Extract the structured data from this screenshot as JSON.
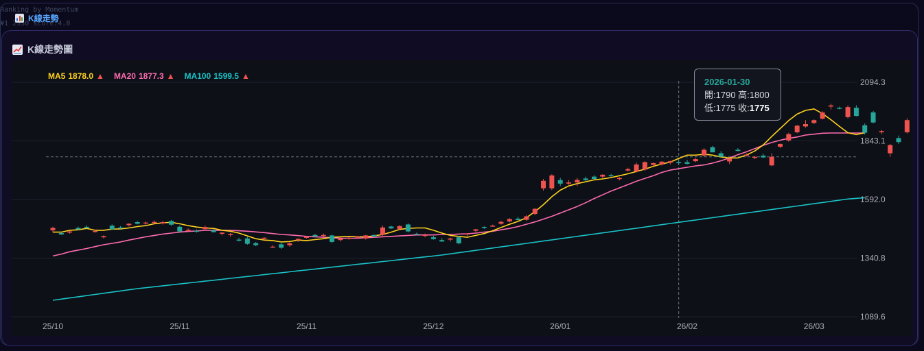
{
  "background_lines": [
    "Ranking by Momentum",
    "#1 2330 score:4.8"
  ],
  "app_tab": {
    "label": "K線走勢",
    "icon": "bar-chart-icon"
  },
  "panel": {
    "title": "K線走勢圖",
    "icon": "line-chart-icon"
  },
  "legend": [
    {
      "name": "MA5",
      "value": "1878.0",
      "arrow": "▲",
      "color": "#ffd21f"
    },
    {
      "name": "MA20",
      "value": "1877.3",
      "arrow": "▲",
      "color": "#ff6bb0"
    },
    {
      "name": "MA100",
      "value": "1599.5",
      "arrow": "▲",
      "color": "#19c3c8"
    }
  ],
  "tooltip": {
    "date": "2026-01-30",
    "open_label": "開:",
    "open": "1790",
    "high_label": "高:",
    "high": "1800",
    "low_label": "低:",
    "low": "1775",
    "close_label": "收:",
    "close": "1775"
  },
  "colors": {
    "up": "#ef5350",
    "down": "#26a69a",
    "arrow": "#ef5350",
    "grid": "#1c2230",
    "crosshair": "#6b7280",
    "axis_text": "#a7adb9"
  },
  "chart_data": {
    "type": "candlestick",
    "y_ticks": [
      2094.3,
      1843.1,
      1592.0,
      1340.8,
      1089.6
    ],
    "ylim": [
      1089.6,
      2094.3
    ],
    "x_tick_labels": [
      "25/10",
      "25/11",
      "25/11",
      "25/12",
      "26/01",
      "26/02",
      "26/03"
    ],
    "x_tick_candle_index": [
      0,
      15,
      30,
      45,
      60,
      75,
      90
    ],
    "crosshair": {
      "candle_index": 74,
      "price": 1775
    },
    "candles": [
      {
        "o": 1460,
        "h": 1475,
        "l": 1450,
        "c": 1470
      },
      {
        "o": 1448,
        "h": 1452,
        "l": 1440,
        "c": 1442
      },
      {
        "o": 1450,
        "h": 1458,
        "l": 1445,
        "c": 1455
      },
      {
        "o": 1470,
        "h": 1476,
        "l": 1460,
        "c": 1464
      },
      {
        "o": 1475,
        "h": 1482,
        "l": 1468,
        "c": 1470
      },
      {
        "o": 1455,
        "h": 1462,
        "l": 1450,
        "c": 1457
      },
      {
        "o": 1430,
        "h": 1438,
        "l": 1425,
        "c": 1435
      },
      {
        "o": 1480,
        "h": 1485,
        "l": 1462,
        "c": 1464
      },
      {
        "o": 1472,
        "h": 1478,
        "l": 1466,
        "c": 1470
      },
      {
        "o": 1482,
        "h": 1490,
        "l": 1476,
        "c": 1488
      },
      {
        "o": 1495,
        "h": 1500,
        "l": 1485,
        "c": 1488
      },
      {
        "o": 1490,
        "h": 1498,
        "l": 1484,
        "c": 1493
      },
      {
        "o": 1496,
        "h": 1502,
        "l": 1490,
        "c": 1496
      },
      {
        "o": 1490,
        "h": 1500,
        "l": 1485,
        "c": 1495
      },
      {
        "o": 1500,
        "h": 1504,
        "l": 1480,
        "c": 1484
      },
      {
        "o": 1475,
        "h": 1480,
        "l": 1450,
        "c": 1455
      },
      {
        "o": 1460,
        "h": 1468,
        "l": 1455,
        "c": 1462
      },
      {
        "o": 1458,
        "h": 1464,
        "l": 1450,
        "c": 1456
      },
      {
        "o": 1465,
        "h": 1480,
        "l": 1458,
        "c": 1474
      },
      {
        "o": 1460,
        "h": 1465,
        "l": 1450,
        "c": 1452
      },
      {
        "o": 1445,
        "h": 1452,
        "l": 1438,
        "c": 1450
      },
      {
        "o": 1440,
        "h": 1448,
        "l": 1432,
        "c": 1444
      },
      {
        "o": 1420,
        "h": 1428,
        "l": 1412,
        "c": 1418
      },
      {
        "o": 1425,
        "h": 1432,
        "l": 1398,
        "c": 1402
      },
      {
        "o": 1405,
        "h": 1410,
        "l": 1392,
        "c": 1396
      },
      {
        "o": 1425,
        "h": 1430,
        "l": 1418,
        "c": 1428
      },
      {
        "o": 1390,
        "h": 1396,
        "l": 1385,
        "c": 1390
      },
      {
        "o": 1400,
        "h": 1410,
        "l": 1380,
        "c": 1385
      },
      {
        "o": 1396,
        "h": 1408,
        "l": 1390,
        "c": 1404
      },
      {
        "o": 1418,
        "h": 1426,
        "l": 1410,
        "c": 1423
      },
      {
        "o": 1430,
        "h": 1436,
        "l": 1424,
        "c": 1432
      },
      {
        "o": 1440,
        "h": 1445,
        "l": 1430,
        "c": 1434
      },
      {
        "o": 1438,
        "h": 1446,
        "l": 1432,
        "c": 1440
      },
      {
        "o": 1438,
        "h": 1442,
        "l": 1405,
        "c": 1410
      },
      {
        "o": 1418,
        "h": 1430,
        "l": 1412,
        "c": 1424
      },
      {
        "o": 1425,
        "h": 1432,
        "l": 1420,
        "c": 1428
      },
      {
        "o": 1430,
        "h": 1436,
        "l": 1424,
        "c": 1433
      },
      {
        "o": 1425,
        "h": 1440,
        "l": 1420,
        "c": 1438
      },
      {
        "o": 1440,
        "h": 1442,
        "l": 1430,
        "c": 1434
      },
      {
        "o": 1440,
        "h": 1480,
        "l": 1436,
        "c": 1472
      },
      {
        "o": 1476,
        "h": 1480,
        "l": 1465,
        "c": 1468
      },
      {
        "o": 1466,
        "h": 1482,
        "l": 1460,
        "c": 1478
      },
      {
        "o": 1485,
        "h": 1490,
        "l": 1450,
        "c": 1455
      },
      {
        "o": 1445,
        "h": 1450,
        "l": 1440,
        "c": 1442
      },
      {
        "o": 1438,
        "h": 1446,
        "l": 1430,
        "c": 1440
      },
      {
        "o": 1430,
        "h": 1436,
        "l": 1420,
        "c": 1422
      },
      {
        "o": 1418,
        "h": 1426,
        "l": 1410,
        "c": 1412
      },
      {
        "o": 1420,
        "h": 1428,
        "l": 1412,
        "c": 1425
      },
      {
        "o": 1430,
        "h": 1436,
        "l": 1400,
        "c": 1404
      },
      {
        "o": 1442,
        "h": 1448,
        "l": 1436,
        "c": 1446
      },
      {
        "o": 1458,
        "h": 1466,
        "l": 1452,
        "c": 1464
      },
      {
        "o": 1474,
        "h": 1478,
        "l": 1466,
        "c": 1470
      },
      {
        "o": 1480,
        "h": 1484,
        "l": 1476,
        "c": 1480
      },
      {
        "o": 1488,
        "h": 1500,
        "l": 1484,
        "c": 1496
      },
      {
        "o": 1498,
        "h": 1512,
        "l": 1494,
        "c": 1508
      },
      {
        "o": 1510,
        "h": 1518,
        "l": 1500,
        "c": 1504
      },
      {
        "o": 1505,
        "h": 1525,
        "l": 1500,
        "c": 1520
      },
      {
        "o": 1530,
        "h": 1555,
        "l": 1525,
        "c": 1552
      },
      {
        "o": 1640,
        "h": 1680,
        "l": 1630,
        "c": 1672
      },
      {
        "o": 1640,
        "h": 1700,
        "l": 1632,
        "c": 1695
      },
      {
        "o": 1675,
        "h": 1685,
        "l": 1650,
        "c": 1660
      },
      {
        "o": 1660,
        "h": 1675,
        "l": 1655,
        "c": 1665
      },
      {
        "o": 1665,
        "h": 1684,
        "l": 1650,
        "c": 1676
      },
      {
        "o": 1682,
        "h": 1690,
        "l": 1670,
        "c": 1675
      },
      {
        "o": 1690,
        "h": 1696,
        "l": 1676,
        "c": 1680
      },
      {
        "o": 1690,
        "h": 1700,
        "l": 1684,
        "c": 1698
      },
      {
        "o": 1696,
        "h": 1702,
        "l": 1688,
        "c": 1694
      },
      {
        "o": 1680,
        "h": 1688,
        "l": 1674,
        "c": 1684
      },
      {
        "o": 1716,
        "h": 1728,
        "l": 1712,
        "c": 1722
      },
      {
        "o": 1712,
        "h": 1750,
        "l": 1708,
        "c": 1742
      },
      {
        "o": 1720,
        "h": 1756,
        "l": 1715,
        "c": 1752
      },
      {
        "o": 1740,
        "h": 1750,
        "l": 1735,
        "c": 1748
      },
      {
        "o": 1742,
        "h": 1756,
        "l": 1738,
        "c": 1754
      },
      {
        "o": 1750,
        "h": 1758,
        "l": 1742,
        "c": 1756
      },
      {
        "o": 1752,
        "h": 1762,
        "l": 1742,
        "c": 1748
      },
      {
        "o": 1752,
        "h": 1762,
        "l": 1742,
        "c": 1745
      },
      {
        "o": 1756,
        "h": 1770,
        "l": 1752,
        "c": 1765
      },
      {
        "o": 1780,
        "h": 1812,
        "l": 1775,
        "c": 1805
      },
      {
        "o": 1816,
        "h": 1822,
        "l": 1800,
        "c": 1794
      },
      {
        "o": 1790,
        "h": 1800,
        "l": 1775,
        "c": 1775
      },
      {
        "o": 1755,
        "h": 1760,
        "l": 1744,
        "c": 1768
      },
      {
        "o": 1805,
        "h": 1812,
        "l": 1798,
        "c": 1800
      },
      {
        "o": 1782,
        "h": 1790,
        "l": 1776,
        "c": 1784
      },
      {
        "o": 1770,
        "h": 1778,
        "l": 1765,
        "c": 1775
      },
      {
        "o": 1780,
        "h": 1788,
        "l": 1770,
        "c": 1772
      },
      {
        "o": 1738,
        "h": 1790,
        "l": 1735,
        "c": 1775
      },
      {
        "o": 1818,
        "h": 1832,
        "l": 1812,
        "c": 1830
      },
      {
        "o": 1845,
        "h": 1878,
        "l": 1840,
        "c": 1872
      },
      {
        "o": 1880,
        "h": 1912,
        "l": 1876,
        "c": 1908
      },
      {
        "o": 1905,
        "h": 1932,
        "l": 1900,
        "c": 1915
      },
      {
        "o": 1920,
        "h": 1935,
        "l": 1915,
        "c": 1932
      },
      {
        "o": 1938,
        "h": 1970,
        "l": 1935,
        "c": 1965
      },
      {
        "o": 1990,
        "h": 2002,
        "l": 1978,
        "c": 1995
      },
      {
        "o": 1985,
        "h": 1990,
        "l": 1978,
        "c": 1982
      },
      {
        "o": 1945,
        "h": 1995,
        "l": 1940,
        "c": 1988
      },
      {
        "o": 1985,
        "h": 1996,
        "l": 1948,
        "c": 1950
      },
      {
        "o": 1910,
        "h": 1918,
        "l": 1870,
        "c": 1878
      },
      {
        "o": 1965,
        "h": 1972,
        "l": 1918,
        "c": 1922
      },
      {
        "o": 1880,
        "h": 1890,
        "l": 1872,
        "c": 1885
      },
      {
        "o": 1790,
        "h": 1830,
        "l": 1775,
        "c": 1825
      },
      {
        "o": 1855,
        "h": 1866,
        "l": 1830,
        "c": 1838
      },
      {
        "o": 1880,
        "h": 1940,
        "l": 1875,
        "c": 1932
      }
    ],
    "series": [
      {
        "name": "MA5",
        "values": [
          1452,
          1452,
          1460,
          1462,
          1468,
          1460,
          1460,
          1465,
          1466,
          1470,
          1476,
          1480,
          1488,
          1492,
          1494,
          1488,
          1480,
          1474,
          1470,
          1468,
          1460,
          1456,
          1448,
          1436,
          1424,
          1418,
          1416,
          1410,
          1412,
          1418,
          1416,
          1420,
          1424,
          1430,
          1432,
          1434,
          1432,
          1432,
          1436,
          1442,
          1452,
          1464,
          1468,
          1470,
          1470,
          1460,
          1448,
          1438,
          1434,
          1430,
          1438,
          1446,
          1458,
          1472,
          1486,
          1498,
          1514,
          1540,
          1570,
          1604,
          1632,
          1650,
          1660,
          1668,
          1676,
          1680,
          1686,
          1694,
          1702,
          1712,
          1722,
          1734,
          1744,
          1752,
          1768,
          1782,
          1782,
          1786,
          1782,
          1774,
          1770,
          1770,
          1782,
          1800,
          1826,
          1862,
          1896,
          1930,
          1958,
          1974,
          1980,
          1960,
          1934,
          1905,
          1878,
          1870,
          1878
        ]
      },
      {
        "name": "MA20",
        "values": [
          1350,
          1358,
          1368,
          1375,
          1382,
          1390,
          1398,
          1404,
          1410,
          1418,
          1425,
          1432,
          1438,
          1444,
          1448,
          1452,
          1455,
          1457,
          1460,
          1460,
          1460,
          1460,
          1458,
          1456,
          1453,
          1450,
          1446,
          1442,
          1440,
          1437,
          1434,
          1432,
          1430,
          1428,
          1426,
          1426,
          1426,
          1428,
          1430,
          1432,
          1434,
          1436,
          1438,
          1440,
          1440,
          1440,
          1442,
          1442,
          1444,
          1445,
          1448,
          1452,
          1456,
          1462,
          1468,
          1476,
          1486,
          1496,
          1508,
          1520,
          1534,
          1548,
          1562,
          1578,
          1596,
          1612,
          1628,
          1642,
          1656,
          1670,
          1682,
          1694,
          1708,
          1718,
          1724,
          1730,
          1736,
          1740,
          1748,
          1758,
          1770,
          1784,
          1796,
          1810,
          1824,
          1836,
          1846,
          1854,
          1860,
          1868,
          1872,
          1876,
          1877,
          1877,
          1877,
          1877,
          1877.3
        ]
      },
      {
        "name": "MA100",
        "values": [
          1160,
          1165,
          1170,
          1175,
          1180,
          1185,
          1190,
          1195,
          1200,
          1205,
          1210,
          1214,
          1218,
          1222,
          1226,
          1230,
          1234,
          1238,
          1242,
          1246,
          1250,
          1254,
          1258,
          1262,
          1266,
          1270,
          1274,
          1278,
          1282,
          1286,
          1290,
          1294,
          1298,
          1302,
          1306,
          1310,
          1314,
          1318,
          1322,
          1326,
          1330,
          1334,
          1338,
          1342,
          1346,
          1350,
          1354,
          1359,
          1364,
          1369,
          1374,
          1379,
          1384,
          1389,
          1394,
          1399,
          1404,
          1409,
          1414,
          1419,
          1424,
          1429,
          1434,
          1439,
          1444,
          1449,
          1454,
          1459,
          1464,
          1469,
          1474,
          1479,
          1484,
          1489,
          1494,
          1499,
          1504,
          1509,
          1514,
          1519,
          1524,
          1529,
          1534,
          1539,
          1544,
          1549,
          1554,
          1559,
          1564,
          1569,
          1574,
          1579,
          1584,
          1589,
          1594,
          1597,
          1599.5
        ]
      }
    ],
    "y_axis_position": "right",
    "grid": true
  }
}
